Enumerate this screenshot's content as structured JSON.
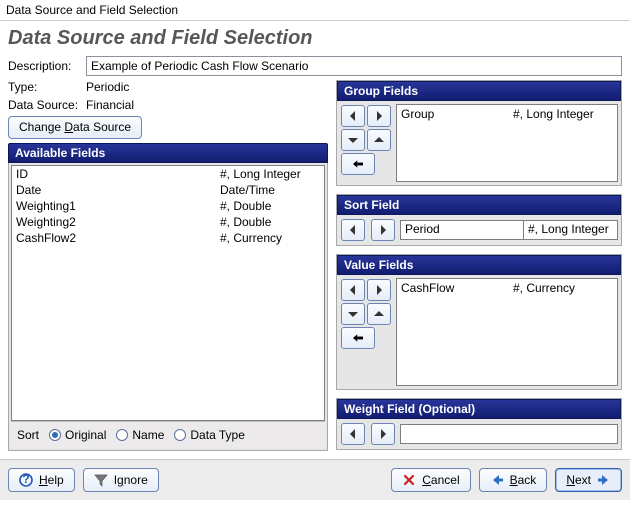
{
  "window_title": "Data Source and Field Selection",
  "heading": "Data Source and Field Selection",
  "labels": {
    "description": "Description:",
    "type": "Type:",
    "data_source": "Data Source:",
    "change_data_source_pre": "Change ",
    "change_data_source_key": "D",
    "change_data_source_post": "ata Source",
    "available_fields": "Available Fields",
    "group_fields": "Group Fields",
    "sort_field": "Sort Field",
    "value_fields": "Value Fields",
    "weight_field": "Weight Field (Optional)",
    "sort": "Sort",
    "original": "Original",
    "name": "Name",
    "data_type": "Data Type"
  },
  "meta": {
    "description_value": "Example of Periodic Cash Flow Scenario",
    "type_value": "Periodic",
    "data_source_value": "Financial"
  },
  "available": [
    {
      "name": "ID",
      "type": "#, Long Integer"
    },
    {
      "name": "Date",
      "type": "Date/Time"
    },
    {
      "name": "Weighting1",
      "type": "#, Double"
    },
    {
      "name": "Weighting2",
      "type": "#, Double"
    },
    {
      "name": "CashFlow2",
      "type": "#, Currency"
    }
  ],
  "sort_selected": "original",
  "group_fields": [
    {
      "name": "Group",
      "type": "#, Long Integer"
    }
  ],
  "sort_field_entry": {
    "name": "Period",
    "type": "#, Long Integer"
  },
  "value_fields": [
    {
      "name": "CashFlow",
      "type": "#, Currency"
    }
  ],
  "weight_field_value": "",
  "footer": {
    "help_pre": "",
    "help_key": "H",
    "help_post": "elp",
    "ignore_pre": "I",
    "ignore_key": "g",
    "ignore_post": "nore",
    "cancel_pre": "",
    "cancel_key": "C",
    "cancel_post": "ancel",
    "back_pre": "",
    "back_key": "B",
    "back_post": "ack",
    "next_pre": "",
    "next_key": "N",
    "next_post": "ext"
  }
}
